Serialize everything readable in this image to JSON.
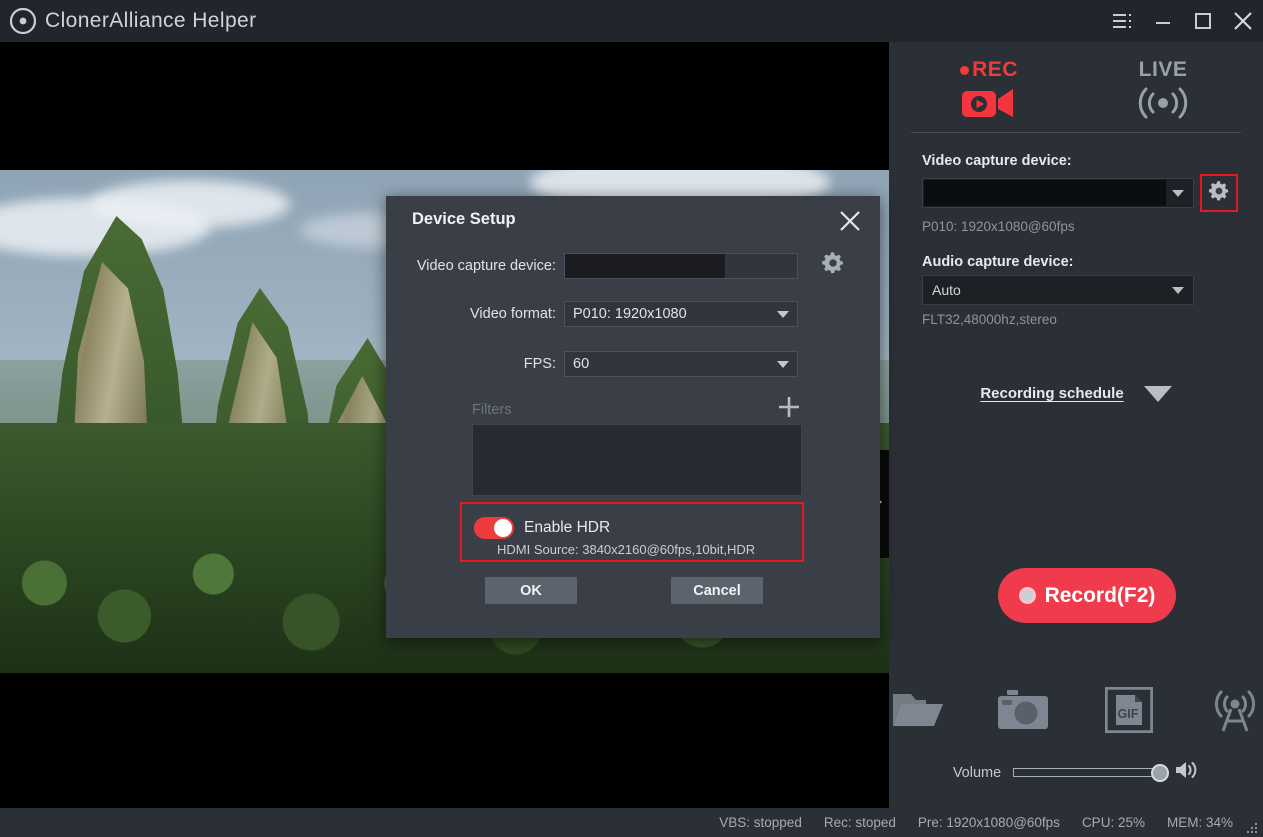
{
  "titlebar": {
    "app_title": "ClonerAlliance Helper",
    "logo_icon": "clover-logo-icon",
    "menu_icon": "hamburger-menu-icon",
    "minimize_icon": "minimize-icon",
    "maximize_icon": "maximize-icon",
    "close_icon": "close-icon"
  },
  "preview": {
    "collapse_icon": "play-triangle-right-icon",
    "scene": "mountain landscape video preview"
  },
  "right_panel": {
    "tabs": [
      {
        "label": "REC",
        "icon": "video-camera-record-icon",
        "active": true,
        "color": "#ef3b3b"
      },
      {
        "label": "LIVE",
        "icon": "broadcast-waves-icon",
        "active": false,
        "color": "#9aa0a8"
      }
    ],
    "video_device": {
      "label": "Video capture device:",
      "value": "",
      "caret_icon": "chevron-down-icon",
      "gear_icon": "gear-icon",
      "hint": "P010: 1920x1080@60fps"
    },
    "audio_device": {
      "label": "Audio capture device:",
      "value": "Auto",
      "caret_icon": "chevron-down-icon",
      "hint": "FLT32,48000hz,stereo"
    },
    "schedule": {
      "link": "Recording schedule",
      "caret_icon": "chevron-down-icon"
    },
    "record_button": {
      "label": "Record(F2)",
      "icon": "record-dot-icon",
      "color": "#ef3b4c"
    },
    "action_icons": [
      {
        "name": "folder-icon"
      },
      {
        "name": "camera-snapshot-icon"
      },
      {
        "name": "gif-file-icon"
      },
      {
        "name": "broadcast-tower-icon"
      }
    ],
    "volume": {
      "label": "Volume",
      "value": 100,
      "speaker_icon": "speaker-volume-icon"
    }
  },
  "dialog": {
    "title": "Device Setup",
    "close_icon": "close-icon",
    "video_device": {
      "label": "Video capture device:",
      "value": "",
      "gear_icon": "gear-icon"
    },
    "video_format": {
      "label": "Video format:",
      "value": "P010: 1920x1080",
      "caret_icon": "chevron-down-icon"
    },
    "fps": {
      "label": "FPS:",
      "value": "60",
      "caret_icon": "chevron-down-icon"
    },
    "filters": {
      "label": "Filters",
      "add_icon": "plus-icon",
      "items": []
    },
    "hdr": {
      "label": "Enable HDR",
      "enabled": true,
      "source_info": "HDMI Source: 3840x2160@60fps,10bit,HDR",
      "highlight_color": "#e01b24"
    },
    "ok_label": "OK",
    "cancel_label": "Cancel"
  },
  "statusbar": {
    "items": [
      "VBS: stopped",
      "Rec: stoped",
      "Pre: 1920x1080@60fps",
      "CPU: 25%",
      "MEM: 34%"
    ],
    "grip_icon": "resize-grip-icon"
  }
}
